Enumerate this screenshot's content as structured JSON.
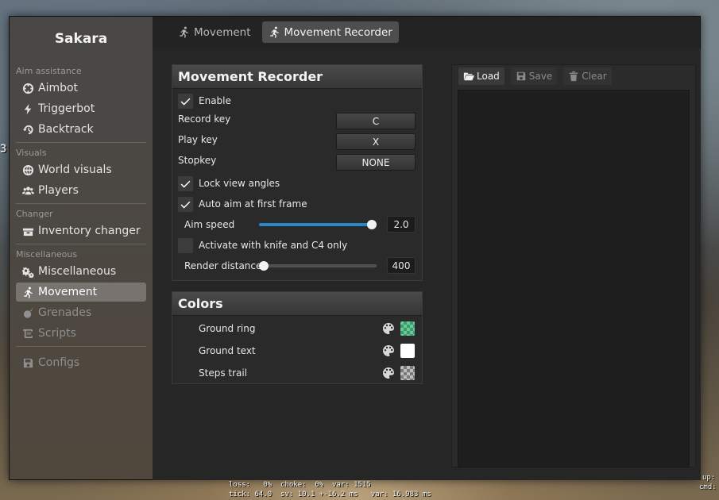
{
  "brand": "Sakara",
  "sidebar": {
    "sections": [
      {
        "label": "Aim assistance",
        "items": [
          {
            "label": "Aimbot",
            "icon": "crosshair-icon"
          },
          {
            "label": "Triggerbot",
            "icon": "bolt-icon"
          },
          {
            "label": "Backtrack",
            "icon": "history-icon"
          }
        ]
      },
      {
        "label": "Visuals",
        "items": [
          {
            "label": "World visuals",
            "icon": "globe-icon"
          },
          {
            "label": "Players",
            "icon": "users-icon"
          }
        ]
      },
      {
        "label": "Changer",
        "items": [
          {
            "label": "Inventory changer",
            "icon": "box-icon"
          }
        ]
      },
      {
        "label": "Miscellaneous",
        "items": [
          {
            "label": "Miscellaneous",
            "icon": "cogs-icon"
          },
          {
            "label": "Movement",
            "icon": "running-icon"
          },
          {
            "label": "Grenades",
            "icon": "bomb-icon"
          },
          {
            "label": "Scripts",
            "icon": "scroll-icon"
          }
        ]
      }
    ],
    "configs": {
      "label": "Configs",
      "icon": "floppy-icon"
    }
  },
  "tabs": [
    {
      "label": "Movement"
    },
    {
      "label": "Movement Recorder"
    }
  ],
  "recorder": {
    "title": "Movement Recorder",
    "enable_label": "Enable",
    "enable_checked": true,
    "record_key_label": "Record key",
    "record_key_value": "C",
    "play_key_label": "Play key",
    "play_key_value": "X",
    "stop_key_label": "Stopkey",
    "stop_key_value": "NONE",
    "lock_view_label": "Lock view angles",
    "lock_view_checked": true,
    "auto_aim_label": "Auto aim at first frame",
    "auto_aim_checked": true,
    "aim_speed_label": "Aim speed",
    "aim_speed_value": "2.0",
    "aim_speed_fraction": 1.0,
    "knife_c4_label": "Activate with knife and C4 only",
    "knife_c4_checked": false,
    "render_distance_label": "Render distance",
    "render_distance_value": "400",
    "render_distance_fraction": 0.0
  },
  "colors": {
    "title": "Colors",
    "items": [
      {
        "label": "Ground ring",
        "swatch": "#6ec597"
      },
      {
        "label": "Ground text",
        "swatch": "#ffffff"
      },
      {
        "label": "Steps trail",
        "swatch": "#bdbdbd"
      }
    ]
  },
  "toolbar": {
    "load": "Load",
    "save": "Save",
    "clear": "Clear"
  },
  "console": {
    "line1": "loss:   0%  choke:  0%  var: 1515",
    "line2": "tick: 64.0  sv: 10.1 +-16.2 ms   var: 16.983 ms"
  },
  "edge": {
    "left_digit": "3",
    "right1": "up:",
    "right2": "cmd:"
  }
}
